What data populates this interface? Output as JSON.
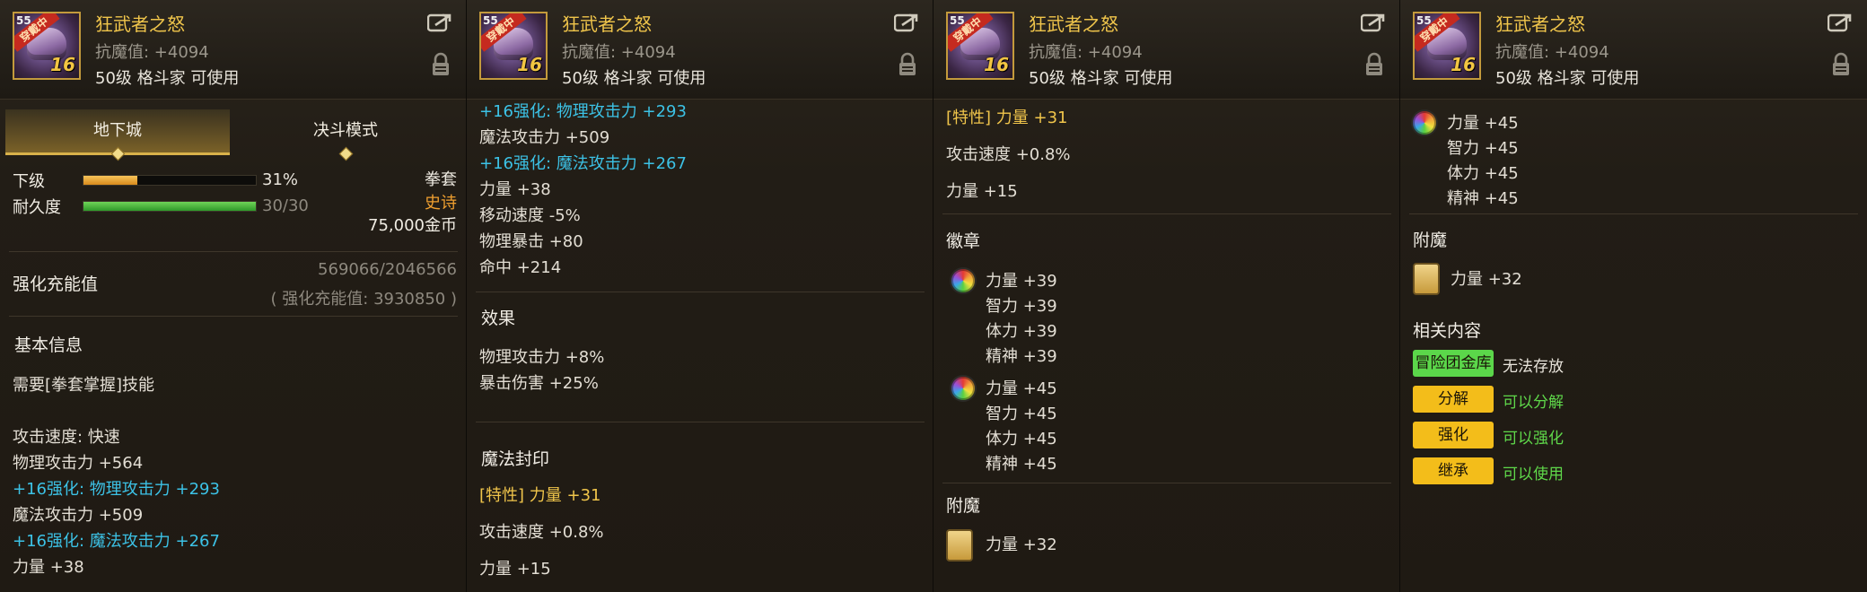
{
  "item": {
    "name": "狂武者之怒",
    "resist": "抗魔值: +4094",
    "requirement": "50级 格斗家 可使用",
    "level_corner": "55",
    "equip_tag": "穿戴中",
    "enhance_level": "16"
  },
  "panel1": {
    "tabs": [
      "地下城",
      "决斗模式"
    ],
    "grade_label": "下级",
    "grade_value": "31%",
    "grade_fraction": 0.31,
    "durability_label": "耐久度",
    "durability_value": "30/30",
    "durability_fraction": 1.0,
    "item_type": "拳套",
    "rarity": "史诗",
    "price": "75,000金币",
    "charge_label": "强化充能值",
    "charge_progress": "569066/2046566",
    "charge_total": "( 强化充能值: 3930850 )",
    "basic_info_title": "基本信息",
    "skill_req": "需要[拳套掌握]技能",
    "attack_speed": "攻击速度: 快速",
    "phys_atk": "物理攻击力 +564",
    "enh_phys": "+16强化: 物理攻击力 +293",
    "mag_atk": "魔法攻击力 +509",
    "enh_mag": "+16强化: 魔法攻击力 +267",
    "strength": "力量 +38"
  },
  "panel2": {
    "lines": [
      {
        "text": "+16强化: 物理攻击力 +293",
        "style": "cyan"
      },
      {
        "text": "魔法攻击力 +509",
        "style": "white"
      },
      {
        "text": "+16强化: 魔法攻击力 +267",
        "style": "cyan"
      },
      {
        "text": "力量 +38",
        "style": "white"
      },
      {
        "text": "移动速度 -5%",
        "style": "white"
      },
      {
        "text": "物理暴击 +80",
        "style": "white"
      },
      {
        "text": "命中 +214",
        "style": "white"
      }
    ],
    "effect_title": "效果",
    "effects": [
      "物理攻击力 +8%",
      "暴击伤害 +25%"
    ],
    "seal_title": "魔法封印",
    "seal_trait": "[特性] 力量 +31",
    "seal_lines": [
      "攻击速度 +0.8%",
      "力量 +15"
    ]
  },
  "panel3": {
    "trait": "[特性] 力量 +31",
    "lines": [
      "攻击速度 +0.8%",
      "力量 +15"
    ],
    "emblem_title": "徽章",
    "emblem1": [
      "力量 +39",
      "智力 +39",
      "体力 +39",
      "精神 +39"
    ],
    "emblem2": [
      "力量 +45",
      "智力 +45",
      "体力 +45",
      "精神 +45"
    ],
    "enchant_title": "附魔",
    "enchant": "力量 +32"
  },
  "panel4": {
    "emblem": [
      "力量 +45",
      "智力 +45",
      "体力 +45",
      "精神 +45"
    ],
    "enchant_title": "附魔",
    "enchant": "力量 +32",
    "related_title": "相关内容",
    "related": [
      {
        "badge": "冒险团金库",
        "status": "无法存放",
        "color": "green",
        "status_color": "#e9e5dc"
      },
      {
        "badge": "分解",
        "status": "可以分解",
        "color": "yellow",
        "status_color": "#5fd84a"
      },
      {
        "badge": "强化",
        "status": "可以强化",
        "color": "yellow",
        "status_color": "#5fd84a"
      },
      {
        "badge": "继承",
        "status": "可以使用",
        "color": "yellow",
        "status_color": "#5fd84a"
      }
    ]
  },
  "colors": {
    "title_gold": "#f0c54b",
    "cyan": "#3cc2e6",
    "green_status": "#5fd84a",
    "orange_rarity": "#f0a030"
  }
}
